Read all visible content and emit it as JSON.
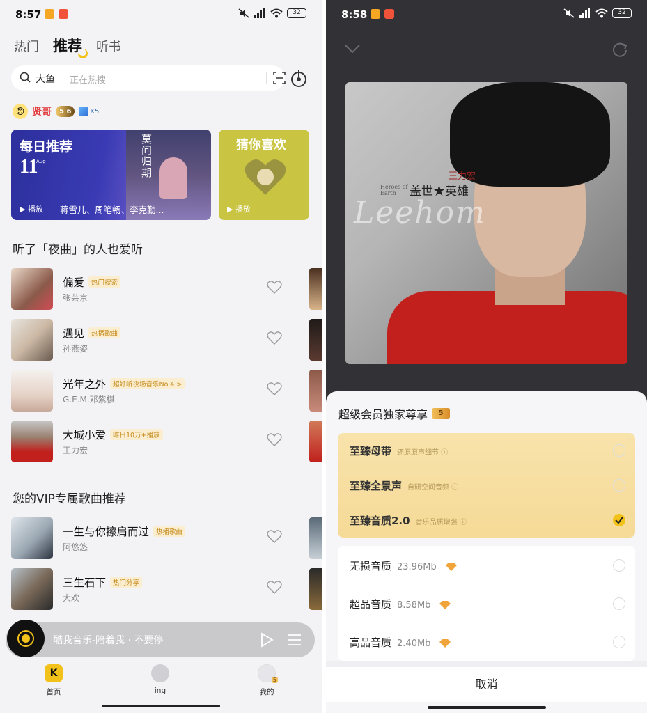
{
  "left": {
    "status": {
      "time": "8:57",
      "battery": "32"
    },
    "tabs": [
      "热门",
      "推荐",
      "听书"
    ],
    "search": {
      "query": "大鱼",
      "hint": "正在热搜"
    },
    "user": {
      "name": "贤哥",
      "vip_level": "5",
      "vip_days": "6",
      "k_level": "K5"
    },
    "daily": {
      "title": "每日推荐",
      "day": "11",
      "month": "Aug",
      "play": "播放",
      "artists": "蒋雪儿、周笔畅、李克勤...",
      "cover_text": "莫问归期"
    },
    "guess": {
      "title": "猜你喜欢",
      "play": "播放"
    },
    "section1": {
      "title": "听了「夜曲」的人也爱听"
    },
    "songs1": [
      {
        "name": "偏爱",
        "tag": "热门搜索",
        "artist": "张芸京"
      },
      {
        "name": "遇见",
        "tag": "热播歌曲",
        "artist": "孙燕姿"
      },
      {
        "name": "光年之外",
        "tag": "超好听夜场音乐No.4 >",
        "artist": "G.E.M.邓紫棋"
      },
      {
        "name": "大城小爱",
        "tag": "昨日10万+播放",
        "artist": "王力宏"
      }
    ],
    "section2": {
      "title": "您的VIP专属歌曲推荐"
    },
    "songs2": [
      {
        "name": "一生与你擦肩而过",
        "tag": "热播歌曲",
        "artist": "阿悠悠"
      },
      {
        "name": "三生石下",
        "tag": "热门分享",
        "artist": "大欢"
      }
    ],
    "miniplayer": {
      "title": "酷我音乐-陪着我 · 不要停"
    },
    "nav": [
      {
        "label": "首页"
      },
      {
        "label": "ing"
      },
      {
        "label": "我的",
        "badge": "5"
      }
    ]
  },
  "right": {
    "status": {
      "time": "8:58",
      "battery": "32"
    },
    "album": {
      "title": "盖世★英雄",
      "artist": "王力宏",
      "en": "Heroes of Earth",
      "script": "Leehom"
    },
    "sheet": {
      "title": "超级会员独家尊享",
      "vip_badge": "5",
      "vip_options": [
        {
          "label": "至臻母带",
          "sub": "还原原声细节 ⓘ",
          "checked": false
        },
        {
          "label": "至臻全景声",
          "sub": "自研空间音频 ⓘ",
          "checked": false
        },
        {
          "label": "至臻音质2.0",
          "sub": "音乐品质增强 ⓘ",
          "checked": true
        }
      ],
      "std_options": [
        {
          "label": "无损音质",
          "size": "23.96Mb"
        },
        {
          "label": "超品音质",
          "size": "8.58Mb"
        },
        {
          "label": "高品音质",
          "size": "2.40Mb"
        }
      ],
      "cancel": "取消"
    }
  },
  "colors": {
    "accent": "#f2c21a",
    "vip_gold": "#f6da97",
    "red_name": "#e23a3a"
  }
}
